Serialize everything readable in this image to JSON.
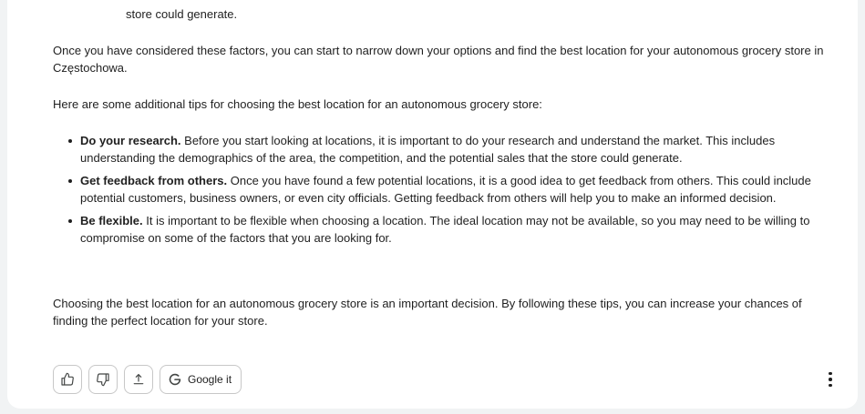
{
  "response": {
    "trailing_text": "store could generate.",
    "paragraph_1": "Once you have considered these factors, you can start to narrow down your options and find the best location for your autonomous grocery store in Częstochowa.",
    "paragraph_2": "Here are some additional tips for choosing the best location for an autonomous grocery store:",
    "tips": [
      {
        "lead": "Do your research.",
        "text": " Before you start looking at locations, it is important to do your research and understand the market. This includes understanding the demographics of the area, the competition, and the potential sales that the store could generate."
      },
      {
        "lead": "Get feedback from others.",
        "text": " Once you have found a few potential locations, it is a good idea to get feedback from others. This could include potential customers, business owners, or even city officials. Getting feedback from others will help you to make an informed decision."
      },
      {
        "lead": "Be flexible.",
        "text": " It is important to be flexible when choosing a location. The ideal location may not be available, so you may need to be willing to compromise on some of the factors that you are looking for."
      }
    ],
    "paragraph_3": "Choosing the best location for an autonomous grocery store is an important decision. By following these tips, you can increase your chances of finding the perfect location for your store."
  },
  "toolbar": {
    "thumbs_up_icon": "thumbs-up-icon",
    "thumbs_down_icon": "thumbs-down-icon",
    "share_icon": "share-icon",
    "google_icon": "google-g-icon",
    "google_it_label": "Google it",
    "more_icon": "more-vertical-icon"
  },
  "colors": {
    "background": "#f1f3f4",
    "card": "#ffffff",
    "text": "#1f1f1f",
    "border": "#c7c7c7"
  }
}
